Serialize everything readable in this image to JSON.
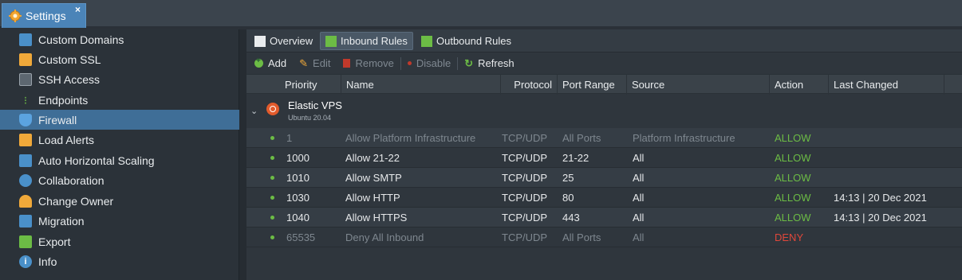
{
  "window_tab": {
    "title": "Settings",
    "close_label": "×"
  },
  "sidebar": {
    "items": [
      {
        "label": "Custom Domains",
        "icon": "domains-icon",
        "color": "#4a90c9"
      },
      {
        "label": "Custom SSL",
        "icon": "certificate-icon",
        "color": "#f0a93a"
      },
      {
        "label": "SSH Access",
        "icon": "terminal-icon",
        "color": "#5d6770"
      },
      {
        "label": "Endpoints",
        "icon": "endpoints-icon",
        "color": "#6cbc45"
      },
      {
        "label": "Firewall",
        "icon": "shield-icon",
        "color": "#4a90c9",
        "active": true
      },
      {
        "label": "Load Alerts",
        "icon": "alert-icon",
        "color": "#f0a93a"
      },
      {
        "label": "Auto Horizontal Scaling",
        "icon": "scaling-icon",
        "color": "#4a90c9"
      },
      {
        "label": "Collaboration",
        "icon": "collaboration-icon",
        "color": "#4a90c9"
      },
      {
        "label": "Change Owner",
        "icon": "change-owner-icon",
        "color": "#f0a93a"
      },
      {
        "label": "Migration",
        "icon": "migration-icon",
        "color": "#4a90c9"
      },
      {
        "label": "Export",
        "icon": "export-icon",
        "color": "#6cbc45"
      },
      {
        "label": "Info",
        "icon": "info-icon",
        "color": "#4a90c9"
      }
    ]
  },
  "subtabs": [
    {
      "label": "Overview",
      "icon": "document-icon",
      "active": false
    },
    {
      "label": "Inbound Rules",
      "icon": "inbound-icon",
      "active": true
    },
    {
      "label": "Outbound Rules",
      "icon": "outbound-icon",
      "active": false
    }
  ],
  "toolbar": {
    "add": "Add",
    "edit": "Edit",
    "remove": "Remove",
    "disable": "Disable",
    "refresh": "Refresh"
  },
  "table": {
    "columns": [
      "Priority",
      "Name",
      "Protocol",
      "Port Range",
      "Source",
      "Action",
      "Last Changed"
    ],
    "group": {
      "name": "Elastic VPS",
      "subtitle": "Ubuntu 20.04",
      "icon": "ubuntu-icon"
    },
    "rows": [
      {
        "priority": "1",
        "name": "Allow Platform Infrastructure",
        "protocol": "TCP/UDP",
        "ports": "All Ports",
        "source": "Platform Infrastructure",
        "action": "ALLOW",
        "changed": "",
        "dim": true
      },
      {
        "priority": "1000",
        "name": "Allow 21-22",
        "protocol": "TCP/UDP",
        "ports": "21-22",
        "source": "All",
        "action": "ALLOW",
        "changed": "",
        "dim": false
      },
      {
        "priority": "1010",
        "name": "Allow SMTP",
        "protocol": "TCP/UDP",
        "ports": "25",
        "source": "All",
        "action": "ALLOW",
        "changed": "",
        "dim": false
      },
      {
        "priority": "1030",
        "name": "Allow HTTP",
        "protocol": "TCP/UDP",
        "ports": "80",
        "source": "All",
        "action": "ALLOW",
        "changed": "14:13 | 20 Dec 2021",
        "dim": false
      },
      {
        "priority": "1040",
        "name": "Allow HTTPS",
        "protocol": "TCP/UDP",
        "ports": "443",
        "source": "All",
        "action": "ALLOW",
        "changed": "14:13 | 20 Dec 2021",
        "dim": false
      },
      {
        "priority": "65535",
        "name": "Deny All Inbound",
        "protocol": "TCP/UDP",
        "ports": "All Ports",
        "source": "All",
        "action": "DENY",
        "changed": "",
        "dim": true
      }
    ]
  },
  "colors": {
    "allow": "#6cbc45",
    "deny": "#e0473a",
    "accent": "#3f6e97"
  }
}
